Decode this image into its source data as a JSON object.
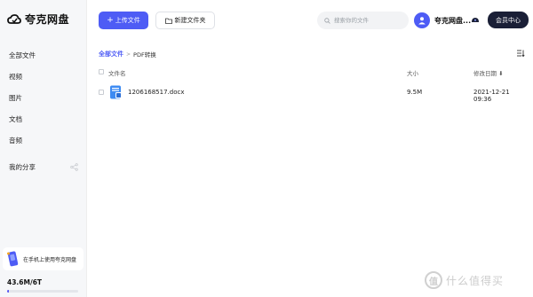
{
  "app": {
    "name": "夸克网盘"
  },
  "sidebar": {
    "items": [
      {
        "label": "全部文件"
      },
      {
        "label": "视频"
      },
      {
        "label": "图片"
      },
      {
        "label": "文档"
      },
      {
        "label": "音频"
      },
      {
        "label": "我的分享"
      }
    ],
    "promo": "在手机上使用夸克网盘",
    "storage": {
      "label": "43.6M/6T",
      "used_fraction": 0.03
    }
  },
  "toolbar": {
    "upload_label": "上传文件",
    "newfolder_label": "新建文件夹"
  },
  "search": {
    "placeholder": "搜索你的文件"
  },
  "user": {
    "name": "夸克网盘...",
    "member_label": "会员中心"
  },
  "breadcrumb": {
    "root": "全部文件",
    "separator": ">",
    "current": "PDF转换"
  },
  "table": {
    "columns": {
      "name": "文件名",
      "size": "大小",
      "modified": "修改日期 ⬇"
    },
    "rows": [
      {
        "name": "1206168517.docx",
        "size": "9.5M",
        "modified": "2021-12-21 09:36"
      }
    ]
  },
  "watermark": {
    "glyph": "值",
    "text": "什么值得买"
  },
  "colors": {
    "accent": "#4e5cf5",
    "member_bg": "#1a1f36",
    "sidebar_bg": "#f6f7f9"
  }
}
